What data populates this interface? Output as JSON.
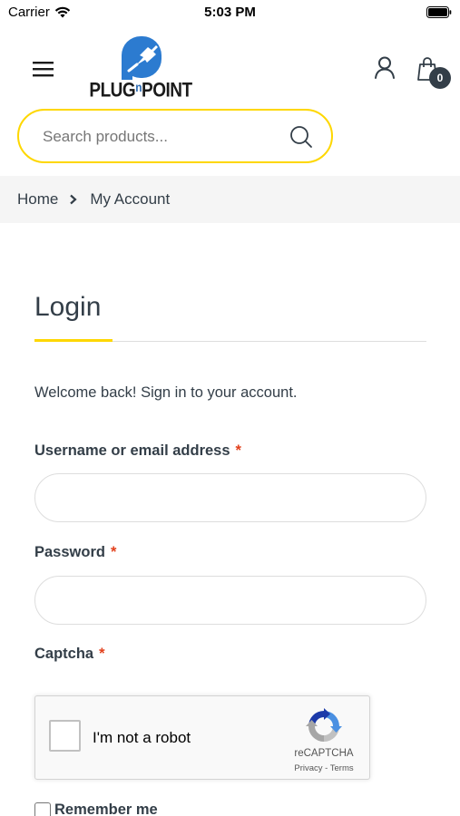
{
  "status_bar": {
    "carrier": "Carrier",
    "time": "5:03 PM"
  },
  "header": {
    "logo_text_part1": "PLUG",
    "logo_text_small": "n",
    "logo_text_part2": "POINT",
    "cart_count": "0"
  },
  "search": {
    "placeholder": "Search products..."
  },
  "breadcrumb": {
    "home": "Home",
    "current": "My Account"
  },
  "login": {
    "title": "Login",
    "welcome": "Welcome back! Sign in to your account.",
    "username_label": "Username or email address",
    "password_label": "Password",
    "captcha_label": "Captcha",
    "required_mark": "*",
    "username_value": "",
    "password_value": ""
  },
  "recaptcha": {
    "label": "I'm not a robot",
    "brand": "reCAPTCHA",
    "links": "Privacy - Terms"
  },
  "remember": {
    "label": "Remember me"
  },
  "colors": {
    "accent": "#fed700",
    "text": "#333e48",
    "required": "#e2401c",
    "breadcrumb_bg": "#f5f5f5"
  },
  "icons": [
    "wifi-icon",
    "battery-icon",
    "menu-icon",
    "user-icon",
    "cart-icon",
    "search-icon",
    "chevron-right-icon",
    "recaptcha-logo-icon"
  ]
}
